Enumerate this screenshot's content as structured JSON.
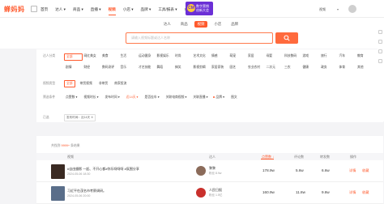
{
  "brand": {
    "logo": "蝉妈妈"
  },
  "nav": {
    "items": [
      {
        "label": "首页",
        "active": false
      },
      {
        "label": "达人 ▾",
        "active": false
      },
      {
        "label": "商品 ▾",
        "active": false
      },
      {
        "label": "直播 ▾",
        "active": false
      },
      {
        "label": "视频",
        "active": true
      },
      {
        "label": "小店 ▾",
        "active": false
      },
      {
        "label": "品牌 ▾",
        "active": false
      },
      {
        "label": "工具/报表 ▾",
        "active": false
      },
      {
        "label": "本地生活",
        "active": false
      }
    ],
    "banner": {
      "badge": "CM",
      "line1": "数字营销",
      "line2": "创新大会"
    },
    "user": "视频",
    "user_chevron": "▾"
  },
  "search": {
    "tabs": [
      {
        "label": "达人",
        "active": false
      },
      {
        "label": "商品",
        "active": false
      },
      {
        "label": "视频",
        "active": true
      },
      {
        "label": "小店",
        "active": false
      },
      {
        "label": "品牌",
        "active": false
      }
    ],
    "placeholder": "请输入视频标题或达人名称",
    "button_icon": "search-icon"
  },
  "filters": {
    "category_label": "达人分类",
    "categories": [
      {
        "label": "全部",
        "active": true
      },
      {
        "label": "网红美女",
        "active": false
      },
      {
        "label": "美食",
        "active": false
      },
      {
        "label": "生活",
        "active": false
      },
      {
        "label": "运动健身",
        "active": false
      },
      {
        "label": "影视娱乐",
        "active": false
      },
      {
        "label": "时尚",
        "active": false
      },
      {
        "label": "艺术文化",
        "active": false
      },
      {
        "label": "情感",
        "active": false
      },
      {
        "label": "萌宠",
        "active": false
      },
      {
        "label": "家居",
        "active": false
      },
      {
        "label": "母婴",
        "active": false
      },
      {
        "label": "科技数码",
        "active": false
      },
      {
        "label": "游戏",
        "active": false
      },
      {
        "label": "旅行",
        "active": false
      },
      {
        "label": "汽车",
        "active": false
      },
      {
        "label": "教育",
        "active": false
      },
      {
        "label": "剧情",
        "active": false
      },
      {
        "label": "财经",
        "active": false
      },
      {
        "label": "数码测评",
        "active": false
      },
      {
        "label": "音乐",
        "active": false
      },
      {
        "label": "才艺技能",
        "active": false
      },
      {
        "label": "舞蹈",
        "active": false
      },
      {
        "label": "搞笑",
        "active": false
      },
      {
        "label": "影视剪辑",
        "active": false
      },
      {
        "label": "家居家装",
        "active": false
      },
      {
        "label": "园艺",
        "active": false
      },
      {
        "label": "农业农村",
        "active": false
      },
      {
        "label": "二次元",
        "active": false
      },
      {
        "label": "三农",
        "active": false
      },
      {
        "label": "健康",
        "active": false
      },
      {
        "label": "政务",
        "active": false
      },
      {
        "label": "体育",
        "active": false
      },
      {
        "label": "其他",
        "active": false
      }
    ],
    "row1": {
      "label": "视频类型",
      "options": [
        {
          "label": "全部",
          "active": true
        },
        {
          "label": "带货视频",
          "active": false
        },
        {
          "label": "非带货",
          "active": false
        },
        {
          "label": "商家投流",
          "active": false
        }
      ]
    },
    "row2": {
      "label": "筛选条件",
      "options": [
        {
          "label": "点赞数 ▾",
          "red": false
        },
        {
          "label": "视频时长 ▾",
          "red": false
        },
        {
          "label": "发布时间 ▾",
          "red": false
        },
        {
          "label": "近14天 ▾",
          "red": true
        },
        {
          "label": "是否挂车 ▾",
          "red": false
        },
        {
          "label": "关联电商视频 ▾",
          "red": false
        },
        {
          "label": "关联直播 ▾",
          "red": false
        },
        {
          "label": "品牌 ▾",
          "red": false
        },
        {
          "label": "图文",
          "red": false
        }
      ]
    },
    "conditions_label": "已选",
    "condition_tag": "发布时间：近14天 ✕"
  },
  "table": {
    "count_prefix": "共找到 ",
    "count_value": "9999+",
    "count_suffix": " 条结果",
    "headers": {
      "video": "视频",
      "creator": "达人",
      "likes": "点赞数 ↓",
      "comments": "评论数",
      "shares": "转发数",
      "actions": "操作"
    },
    "rows": [
      {
        "title": "#自由摄影 一起、不开心都#你乐呀呀呀 #氛围分享",
        "sub": "2024-05-06 18:30",
        "creator": "黎黎",
        "creator_meta": "粉丝 8.9w",
        "likes": "178.9w",
        "comments": "5.6w",
        "shares": "6.6w",
        "detail": "详情",
        "favorite": "收藏",
        "thumb_color": "#3a2a22",
        "avatar_color": "#8b6b5a"
      },
      {
        "title": "习近平在茂名市考察调研。",
        "sub": "2024-05-06 20:00",
        "creator": "人民日报",
        "creator_meta": "粉丝 1.5亿",
        "likes": "160.9w",
        "comments": "11.8w",
        "shares": "9.8w",
        "detail": "详情",
        "favorite": "收藏",
        "thumb_color": "#5a6e8a",
        "avatar_color": "#c9302c"
      }
    ]
  },
  "colors": {
    "accent": "#ff5a2d",
    "banner": "#6b2fd6"
  }
}
